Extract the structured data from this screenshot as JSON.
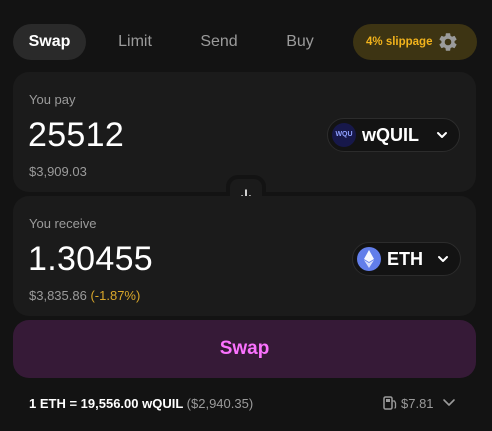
{
  "tabs": [
    {
      "label": "Swap",
      "active": true
    },
    {
      "label": "Limit",
      "active": false
    },
    {
      "label": "Send",
      "active": false
    },
    {
      "label": "Buy",
      "active": false
    }
  ],
  "slippage": {
    "label": "4% slippage",
    "icon": "gear-icon"
  },
  "pay": {
    "label": "You pay",
    "amount": "25512",
    "usd": "$3,909.03",
    "token": {
      "symbol": "wQUIL",
      "logo_text": "WQU",
      "logo_color": "#17184a"
    }
  },
  "switch": {
    "icon": "arrow-down-icon"
  },
  "receive": {
    "label": "You receive",
    "amount": "1.30455",
    "usd": "$3,835.86",
    "price_impact": "(-1.87%)",
    "token": {
      "symbol": "ETH",
      "logo_color": "#627eea"
    }
  },
  "swap_button": {
    "label": "Swap"
  },
  "rate": {
    "text": "1 ETH = 19,556.00 wQUIL",
    "usd": "($2,940.35)"
  },
  "gas": {
    "value": "$7.81",
    "icon": "gas-pump-icon"
  },
  "colors": {
    "accent": "#fc72ff",
    "warning": "#f2b31c",
    "background": "#131313",
    "panel": "#1b1b1b"
  }
}
